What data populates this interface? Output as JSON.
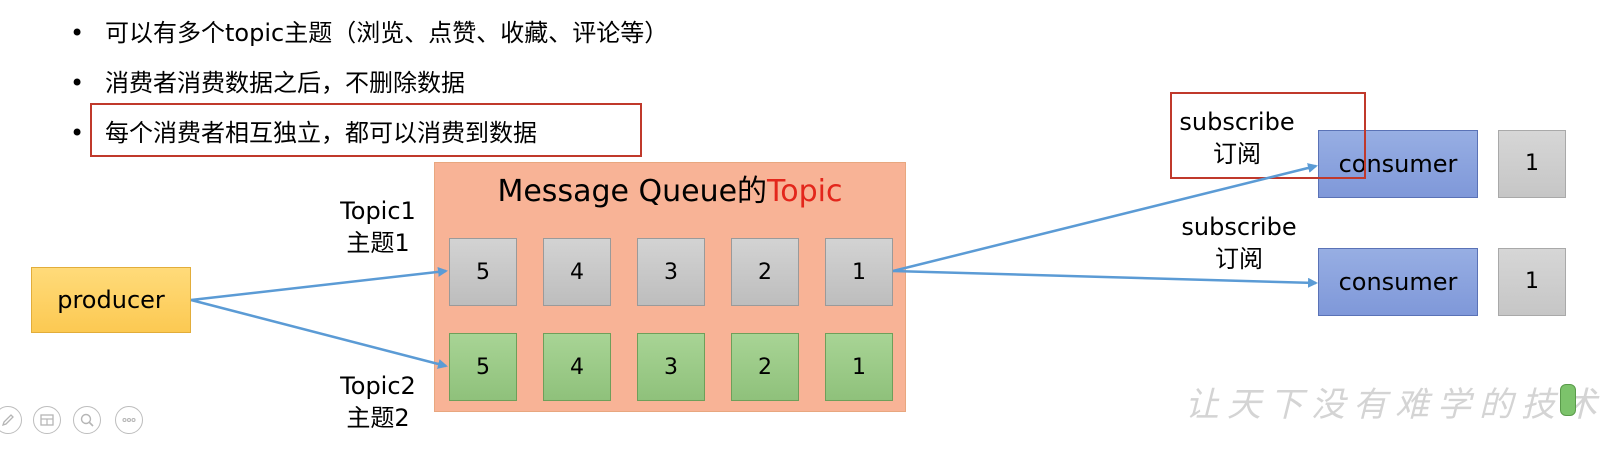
{
  "bullets": [
    "可以有多个topic主题（浏览、点赞、收藏、评论等）",
    "消费者消费数据之后，不删除数据",
    "每个消费者相互独立，都可以消费到数据"
  ],
  "bullet_symbol": "•",
  "mq": {
    "title_prefix": "Message Queue的",
    "title_accent": "Topic",
    "topics": [
      {
        "label_line1": "Topic1",
        "label_line2": "主题1",
        "cells": [
          "5",
          "4",
          "3",
          "2",
          "1"
        ]
      },
      {
        "label_line1": "Topic2",
        "label_line2": "主题2",
        "cells": [
          "5",
          "4",
          "3",
          "2",
          "1"
        ]
      }
    ]
  },
  "producer": {
    "label": "producer"
  },
  "consumers": [
    {
      "label": "consumer",
      "offset": "1",
      "subscribe_line1": "subscribe",
      "subscribe_line2": "订阅"
    },
    {
      "label": "consumer",
      "offset": "1",
      "subscribe_line1": "subscribe",
      "subscribe_line2": "订阅"
    }
  ],
  "watermark": "让天下没有难学的技术",
  "colors": {
    "highlight_border": "#c0392b",
    "topic_accent": "#e3261b",
    "panel_bg": "#f8b396",
    "arrow": "#5b9bd5"
  },
  "icons": [
    "edit-icon",
    "slides-icon",
    "zoom-icon",
    "more-icon"
  ]
}
